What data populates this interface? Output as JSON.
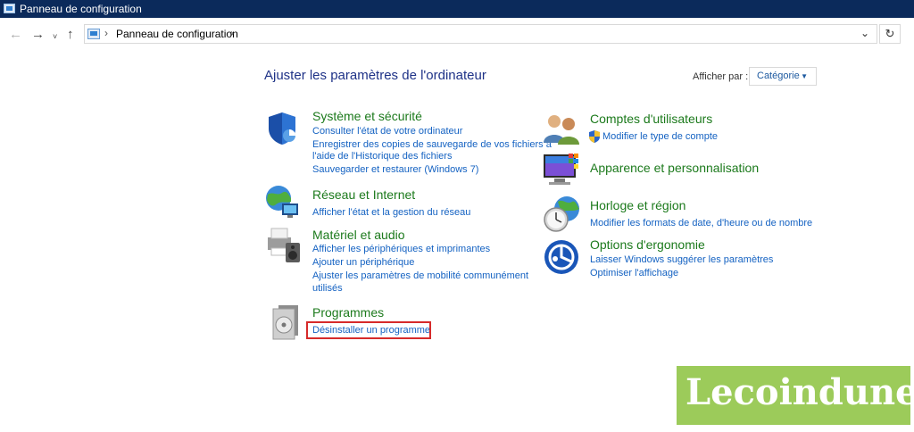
{
  "window": {
    "title": "Panneau de configuration"
  },
  "nav": {
    "back_icon": "arrow-left-icon",
    "forward_icon": "arrow-right-icon",
    "recent_icon": "chevron-down-icon",
    "up_icon": "arrow-up-icon",
    "breadcrumb": [
      "Panneau de configuration"
    ],
    "refresh_icon": "refresh-icon"
  },
  "main": {
    "heading": "Ajuster les paramètres de l'ordinateur",
    "view_by_label": "Afficher par :",
    "view_by_value": "Catégorie"
  },
  "left": [
    {
      "title": "Système et sécurité",
      "icon": "shield-icon",
      "links": [
        "Consulter l'état de votre ordinateur",
        "Enregistrer des copies de sauvegarde de vos fichiers à",
        "l'aide de l'Historique des fichiers",
        "Sauvegarder et restaurer (Windows 7)"
      ]
    },
    {
      "title": "Réseau et Internet",
      "icon": "network-globe-icon",
      "links": [
        "Afficher l'état et la gestion du réseau"
      ]
    },
    {
      "title": "Matériel et audio",
      "icon": "printer-speaker-icon",
      "links": [
        "Afficher les périphériques et imprimantes",
        "Ajouter un périphérique",
        "Ajuster les paramètres de mobilité communément",
        "utilisés"
      ]
    },
    {
      "title": "Programmes",
      "icon": "programs-disc-icon",
      "links": [
        "Désinstaller un programme"
      ]
    }
  ],
  "right": [
    {
      "title": "Comptes d'utilisateurs",
      "icon": "users-icon",
      "links": [
        "Modifier le type de compte"
      ]
    },
    {
      "title": "Apparence et personnalisation",
      "icon": "monitor-palette-icon",
      "links": []
    },
    {
      "title": "Horloge et région",
      "icon": "clock-globe-icon",
      "links": [
        "Modifier les formats de date, d'heure ou de nombre"
      ]
    },
    {
      "title": "Options d'ergonomie",
      "icon": "ease-of-access-icon",
      "links": [
        "Laisser Windows suggérer les paramètres",
        "Optimiser l'affichage"
      ]
    }
  ],
  "watermark": {
    "text": "Lecoindunet"
  },
  "colors": {
    "titlebar": "#0b2a5b",
    "category_title": "#1c7a1c",
    "link": "#1462c2",
    "heading": "#1e3287",
    "highlight": "#d62a2a",
    "watermark_bg": "#9ccb5a"
  }
}
